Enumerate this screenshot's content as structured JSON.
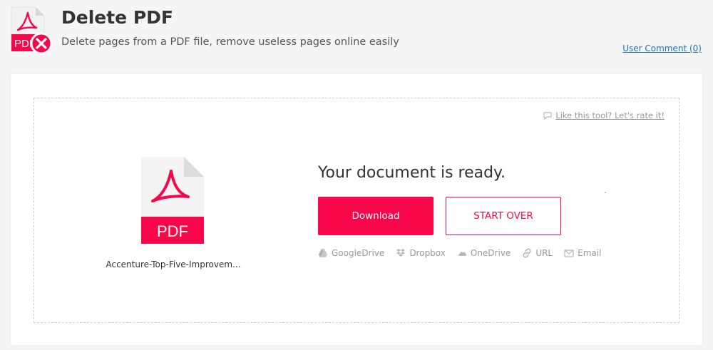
{
  "header": {
    "logo_text": "PDF",
    "title": "Delete PDF",
    "subtitle": "Delete pages from a PDF file, remove useless pages online easily",
    "user_comment": "User Comment (0)"
  },
  "card": {
    "rate_link": "Like this tool? Let's rate it!",
    "file": {
      "icon_text": "PDF",
      "name": "Accenture-Top-Five-Improvem..."
    },
    "ready_title": "Your document is ready.",
    "download_label": "Download",
    "start_over_label": "START OVER",
    "share": [
      {
        "label": "GoogleDrive",
        "icon": "google-drive-icon"
      },
      {
        "label": "Dropbox",
        "icon": "dropbox-icon"
      },
      {
        "label": "OneDrive",
        "icon": "onedrive-icon"
      },
      {
        "label": "URL",
        "icon": "link-icon"
      },
      {
        "label": "Email",
        "icon": "email-icon"
      }
    ]
  },
  "colors": {
    "accent": "#f7074a",
    "link": "#1a73c8",
    "muted": "#999999"
  }
}
